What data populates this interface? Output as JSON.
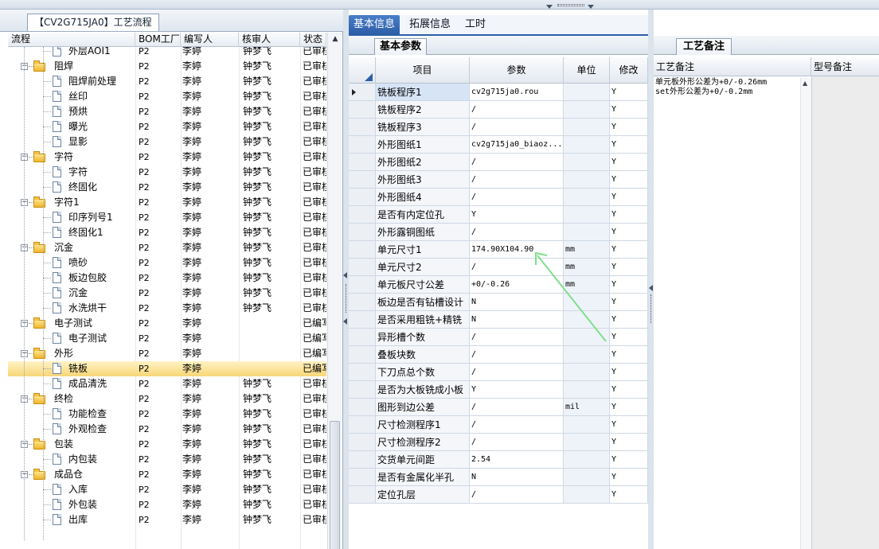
{
  "left_panel": {
    "tab_label": "【CV2G715JA0】工艺流程",
    "columns": [
      "流程",
      "BOM工厂",
      "编写人",
      "核审人",
      "状态"
    ],
    "rows": [
      {
        "name": "外层AOI1",
        "level": 2,
        "type": "doc",
        "bom": "P2",
        "writer": "李婷",
        "reviewer": "钟梦飞",
        "status": "已审核"
      },
      {
        "name": "阻焊",
        "level": 1,
        "type": "folder",
        "bom": "P2",
        "writer": "李婷",
        "reviewer": "钟梦飞",
        "status": "已审核"
      },
      {
        "name": "阻焊前处理",
        "level": 2,
        "type": "doc",
        "bom": "P2",
        "writer": "李婷",
        "reviewer": "钟梦飞",
        "status": "已审核"
      },
      {
        "name": "丝印",
        "level": 2,
        "type": "doc",
        "bom": "P2",
        "writer": "李婷",
        "reviewer": "钟梦飞",
        "status": "已审核"
      },
      {
        "name": "预烘",
        "level": 2,
        "type": "doc",
        "bom": "P2",
        "writer": "李婷",
        "reviewer": "钟梦飞",
        "status": "已审核"
      },
      {
        "name": "曝光",
        "level": 2,
        "type": "doc",
        "bom": "P2",
        "writer": "李婷",
        "reviewer": "钟梦飞",
        "status": "已审核"
      },
      {
        "name": "显影",
        "level": 2,
        "type": "doc",
        "bom": "P2",
        "writer": "李婷",
        "reviewer": "钟梦飞",
        "status": "已审核"
      },
      {
        "name": "字符",
        "level": 1,
        "type": "folder",
        "bom": "P2",
        "writer": "李婷",
        "reviewer": "钟梦飞",
        "status": "已审核"
      },
      {
        "name": "字符",
        "level": 2,
        "type": "doc",
        "bom": "P2",
        "writer": "李婷",
        "reviewer": "钟梦飞",
        "status": "已审核"
      },
      {
        "name": "终固化",
        "level": 2,
        "type": "doc",
        "bom": "P2",
        "writer": "李婷",
        "reviewer": "钟梦飞",
        "status": "已审核"
      },
      {
        "name": "字符1",
        "level": 1,
        "type": "folder",
        "bom": "P2",
        "writer": "李婷",
        "reviewer": "钟梦飞",
        "status": "已审核"
      },
      {
        "name": "印序列号1",
        "level": 2,
        "type": "doc",
        "bom": "P2",
        "writer": "李婷",
        "reviewer": "钟梦飞",
        "status": "已审核"
      },
      {
        "name": "终固化1",
        "level": 2,
        "type": "doc",
        "bom": "P2",
        "writer": "李婷",
        "reviewer": "钟梦飞",
        "status": "已审核"
      },
      {
        "name": "沉金",
        "level": 1,
        "type": "folder",
        "bom": "P2",
        "writer": "李婷",
        "reviewer": "钟梦飞",
        "status": "已审核"
      },
      {
        "name": "喷砂",
        "level": 2,
        "type": "doc",
        "bom": "P2",
        "writer": "李婷",
        "reviewer": "钟梦飞",
        "status": "已审核"
      },
      {
        "name": "板边包胶",
        "level": 2,
        "type": "doc",
        "bom": "P2",
        "writer": "李婷",
        "reviewer": "钟梦飞",
        "status": "已审核"
      },
      {
        "name": "沉金",
        "level": 2,
        "type": "doc",
        "bom": "P2",
        "writer": "李婷",
        "reviewer": "钟梦飞",
        "status": "已审核"
      },
      {
        "name": "水洗烘干",
        "level": 2,
        "type": "doc",
        "bom": "P2",
        "writer": "李婷",
        "reviewer": "钟梦飞",
        "status": "已审核"
      },
      {
        "name": "电子测试",
        "level": 1,
        "type": "folder",
        "bom": "P2",
        "writer": "李婷",
        "reviewer": "",
        "status": "已编写"
      },
      {
        "name": "电子测试",
        "level": 2,
        "type": "doc",
        "bom": "P2",
        "writer": "李婷",
        "reviewer": "",
        "status": "已编写"
      },
      {
        "name": "外形",
        "level": 1,
        "type": "folder",
        "bom": "P2",
        "writer": "李婷",
        "reviewer": "",
        "status": "已编写"
      },
      {
        "name": "铣板",
        "level": 2,
        "type": "doc",
        "bom": "P2",
        "writer": "李婷",
        "reviewer": "",
        "status": "已编写",
        "selected": true
      },
      {
        "name": "成品清洗",
        "level": 2,
        "type": "doc",
        "bom": "P2",
        "writer": "李婷",
        "reviewer": "钟梦飞",
        "status": "已审核"
      },
      {
        "name": "终检",
        "level": 1,
        "type": "folder",
        "bom": "P2",
        "writer": "李婷",
        "reviewer": "钟梦飞",
        "status": "已审核"
      },
      {
        "name": "功能检查",
        "level": 2,
        "type": "doc",
        "bom": "P2",
        "writer": "李婷",
        "reviewer": "钟梦飞",
        "status": "已审核"
      },
      {
        "name": "外观检查",
        "level": 2,
        "type": "doc",
        "bom": "P2",
        "writer": "李婷",
        "reviewer": "钟梦飞",
        "status": "已审核"
      },
      {
        "name": "包装",
        "level": 1,
        "type": "folder",
        "bom": "P2",
        "writer": "李婷",
        "reviewer": "钟梦飞",
        "status": "已审核"
      },
      {
        "name": "内包装",
        "level": 2,
        "type": "doc",
        "bom": "P2",
        "writer": "李婷",
        "reviewer": "钟梦飞",
        "status": "已审核"
      },
      {
        "name": "成品仓",
        "level": 1,
        "type": "folder",
        "bom": "P2",
        "writer": "李婷",
        "reviewer": "钟梦飞",
        "status": "已审核"
      },
      {
        "name": "入库",
        "level": 2,
        "type": "doc",
        "bom": "P2",
        "writer": "李婷",
        "reviewer": "钟梦飞",
        "status": "已审核"
      },
      {
        "name": "外包装",
        "level": 2,
        "type": "doc",
        "bom": "P2",
        "writer": "李婷",
        "reviewer": "钟梦飞",
        "status": "已审核"
      },
      {
        "name": "出库",
        "level": 2,
        "type": "doc",
        "bom": "P2",
        "writer": "李婷",
        "reviewer": "钟梦飞",
        "status": "已审核"
      }
    ]
  },
  "middle_panel": {
    "tabs": [
      "基本信息",
      "拓展信息",
      "工时"
    ],
    "active_tab": "基本信息",
    "sub_tab": "基本参数",
    "columns": [
      "项目",
      "参数",
      "单位",
      "修改"
    ],
    "rows": [
      {
        "item": "铣板程序1",
        "param": "cv2g715ja0.rou",
        "unit": "",
        "mod": "Y",
        "current": true
      },
      {
        "item": "铣板程序2",
        "param": "/",
        "unit": "",
        "mod": "Y"
      },
      {
        "item": "铣板程序3",
        "param": "/",
        "unit": "",
        "mod": "Y"
      },
      {
        "item": "外形图纸1",
        "param": "cv2g715ja0_biaoz...",
        "unit": "",
        "mod": "Y"
      },
      {
        "item": "外形图纸2",
        "param": "/",
        "unit": "",
        "mod": "Y"
      },
      {
        "item": "外形图纸3",
        "param": "/",
        "unit": "",
        "mod": "Y"
      },
      {
        "item": "外形图纸4",
        "param": "/",
        "unit": "",
        "mod": "Y"
      },
      {
        "item": "是否有内定位孔",
        "param": "Y",
        "unit": "",
        "mod": "Y"
      },
      {
        "item": "外形露铜图纸",
        "param": "/",
        "unit": "",
        "mod": "Y"
      },
      {
        "item": "单元尺寸1",
        "param": "174.90X104.90",
        "unit": "mm",
        "mod": "Y"
      },
      {
        "item": "单元尺寸2",
        "param": "/",
        "unit": "mm",
        "mod": "Y"
      },
      {
        "item": "单元板尺寸公差",
        "param": "+0/-0.26",
        "unit": "mm",
        "mod": "Y"
      },
      {
        "item": "板边是否有钻槽设计",
        "param": "N",
        "unit": "",
        "mod": "Y"
      },
      {
        "item": "是否采用粗铣+精铣",
        "param": "N",
        "unit": "",
        "mod": "Y"
      },
      {
        "item": "异形槽个数",
        "param": "/",
        "unit": "",
        "mod": "Y"
      },
      {
        "item": "叠板块数",
        "param": "/",
        "unit": "",
        "mod": "Y"
      },
      {
        "item": "下刀点总个数",
        "param": "/",
        "unit": "",
        "mod": "Y"
      },
      {
        "item": "是否为大板铣成小板",
        "param": "Y",
        "unit": "",
        "mod": "Y"
      },
      {
        "item": "图形到边公差",
        "param": "/",
        "unit": "mil",
        "mod": "Y"
      },
      {
        "item": "尺寸检测程序1",
        "param": "/",
        "unit": "",
        "mod": "Y"
      },
      {
        "item": "尺寸检测程序2",
        "param": "/",
        "unit": "",
        "mod": "Y"
      },
      {
        "item": "交货单元间距",
        "param": "2.54",
        "unit": "",
        "mod": "Y"
      },
      {
        "item": "是否有金属化半孔",
        "param": "N",
        "unit": "",
        "mod": "Y"
      },
      {
        "item": "定位孔层",
        "param": "/",
        "unit": "",
        "mod": "Y"
      }
    ]
  },
  "right_panel": {
    "tab": "工艺备注",
    "columns": [
      "工艺备注",
      "型号备注"
    ],
    "note": "单元板外形公差为+0/-0.26mm\nset外形公差为+0/-0.2mm"
  },
  "colors": {
    "accent": "#2d5fa8",
    "selected_row": "#f7d678",
    "annotation_arrow": "#7ee08a"
  }
}
